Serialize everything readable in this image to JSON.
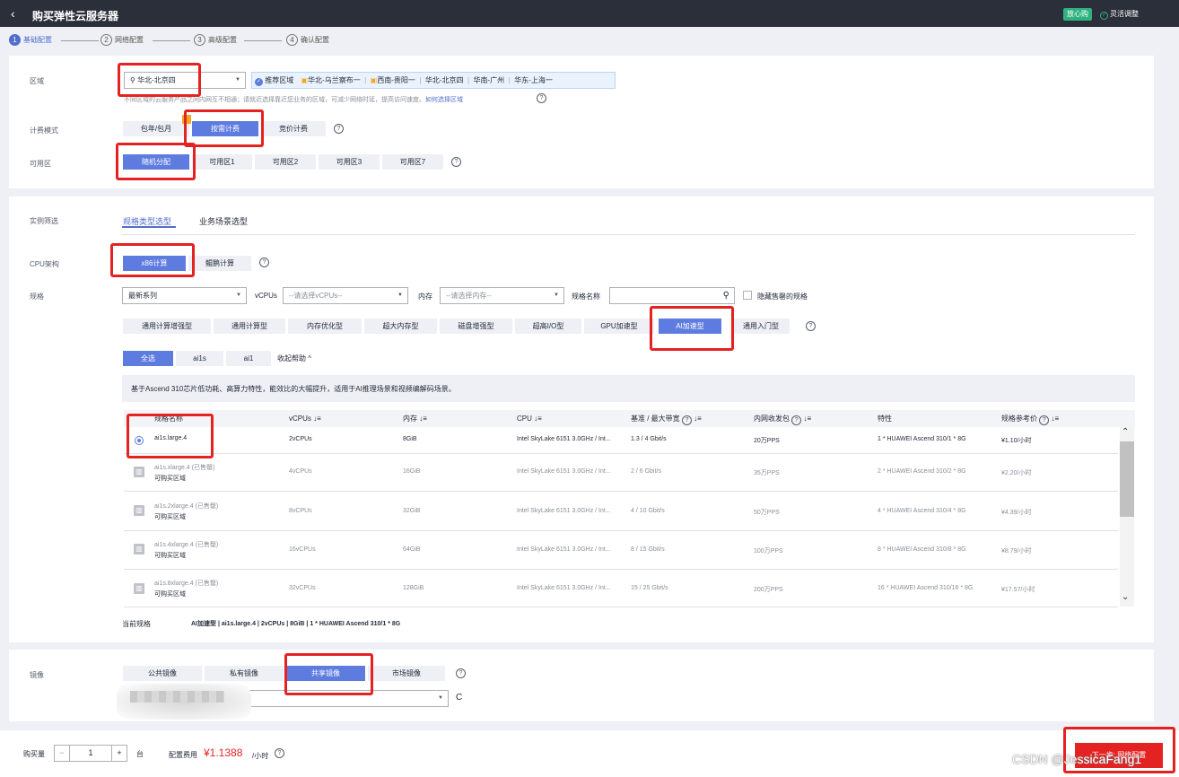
{
  "header": {
    "title": "购买弹性云服务器",
    "badge": "放心购",
    "flex_adjust": "灵活调整"
  },
  "steps": [
    {
      "num": "1",
      "label": "基础配置"
    },
    {
      "num": "2",
      "label": "网络配置"
    },
    {
      "num": "3",
      "label": "高级配置"
    },
    {
      "num": "4",
      "label": "确认配置"
    }
  ],
  "region": {
    "label": "区域",
    "selected": "华北-北京四",
    "recommend_label": "推荐区域",
    "recommend": [
      "华北-乌兰察布一",
      "西南-贵阳一",
      "华北-北京四",
      "华南-广州",
      "华东-上海一"
    ],
    "note": "不同区域的云服务产品之间内网互不相通；请就近选择靠近您业务的区域，可减少网络时延，提高访问速度。",
    "note_link": "如何选择区域"
  },
  "billing": {
    "label": "计费模式",
    "options": [
      "包年/包月",
      "按需计费",
      "竞价计费"
    ]
  },
  "az": {
    "label": "可用区",
    "options": [
      "随机分配",
      "可用区1",
      "可用区2",
      "可用区3",
      "可用区7"
    ]
  },
  "instance": {
    "label": "实例筛选",
    "tabs": [
      "规格类型选型",
      "业务场景选型"
    ],
    "cpu_label": "CPU架构",
    "cpu_options": [
      "x86计算",
      "鲲鹏计算"
    ],
    "spec_label": "规格",
    "series": "最新系列",
    "vcpus_label": "vCPUs",
    "vcpus_placeholder": "--请选择vCPUs--",
    "mem_label": "内存",
    "mem_placeholder": "--请选择内存--",
    "specname_label": "规格名称",
    "hide_sold": "隐藏售罄的规格",
    "types": [
      "通用计算增强型",
      "通用计算型",
      "内存优化型",
      "超大内存型",
      "磁盘增强型",
      "超高I/O型",
      "GPU加速型",
      "AI加速型",
      "通用入门型"
    ],
    "subtypes": [
      "全选",
      "ai1s",
      "ai1"
    ],
    "collapse": "收起帮助",
    "desc": "基于Ascend 310芯片低功耗、高算力特性，能效比的大幅提升，适用于AI推理场景和视频编解码场景。",
    "columns": [
      "规格名称",
      "vCPUs",
      "内存",
      "CPU",
      "基准 / 最大带宽",
      "内网收发包",
      "特性",
      "规格参考价"
    ],
    "rows": [
      {
        "name": "ai1s.large.4",
        "link": "",
        "vcpus": "2vCPUs",
        "mem": "8GiB",
        "cpu": "Intel SkyLake 6151 3.0GHz / Int...",
        "bw": "1.3 / 4 Gbit/s",
        "pps": "20万PPS",
        "feature": "1 * HUAWEI Ascend 310/1 * 8G",
        "price": "¥1.10/小时"
      },
      {
        "name": "ai1s.xlarge.4 (已售罄)",
        "link": "可购买区域",
        "vcpus": "4vCPUs",
        "mem": "16GiB",
        "cpu": "Intel SkyLake 6151 3.0GHz / Int...",
        "bw": "2 / 6 Gbit/s",
        "pps": "35万PPS",
        "feature": "2 * HUAWEI Ascend 310/2 * 8G",
        "price": "¥2.20/小时"
      },
      {
        "name": "ai1s.2xlarge.4 (已售罄)",
        "link": "可购买区域",
        "vcpus": "8vCPUs",
        "mem": "32GiB",
        "cpu": "Intel SkyLake 6151 3.0GHz / Int...",
        "bw": "4 / 10 Gbit/s",
        "pps": "50万PPS",
        "feature": "4 * HUAWEI Ascend 310/4 * 8G",
        "price": "¥4.39/小时"
      },
      {
        "name": "ai1s.4xlarge.4 (已售罄)",
        "link": "可购买区域",
        "vcpus": "16vCPUs",
        "mem": "64GiB",
        "cpu": "Intel SkyLake 6151 3.0GHz / Int...",
        "bw": "8 / 15 Gbit/s",
        "pps": "100万PPS",
        "feature": "8 * HUAWEI Ascend 310/8 * 8G",
        "price": "¥8.79/小时"
      },
      {
        "name": "ai1s.8xlarge.4 (已售罄)",
        "link": "可购买区域",
        "vcpus": "32vCPUs",
        "mem": "128GiB",
        "cpu": "Intel SkyLake 6151 3.0GHz / Int...",
        "bw": "15 / 25 Gbit/s",
        "pps": "200万PPS",
        "feature": "16 * HUAWEI Ascend 310/16 * 8G",
        "price": "¥17.57/小时"
      }
    ],
    "current_label": "当前规格",
    "current_value": "AI加速型 | ai1s.large.4 | 2vCPUs | 8GiB | 1 * HUAWEI Ascend 310/1 * 8G"
  },
  "image": {
    "label": "镜像",
    "options": [
      "公共镜像",
      "私有镜像",
      "共享镜像",
      "市场镜像"
    ],
    "refresh": "C"
  },
  "footer": {
    "qty_label": "购买量",
    "qty": "1",
    "unit": "台",
    "fee_label": "配置费用",
    "price": "¥1.1388",
    "per": "/小时",
    "next": "下一步: 网络配置"
  },
  "watermark": "CSDN @JessicaFang1",
  "colors": {
    "primary": "#5e7ce0",
    "highlight": "#e52222",
    "topbar": "#2b2f3a"
  }
}
